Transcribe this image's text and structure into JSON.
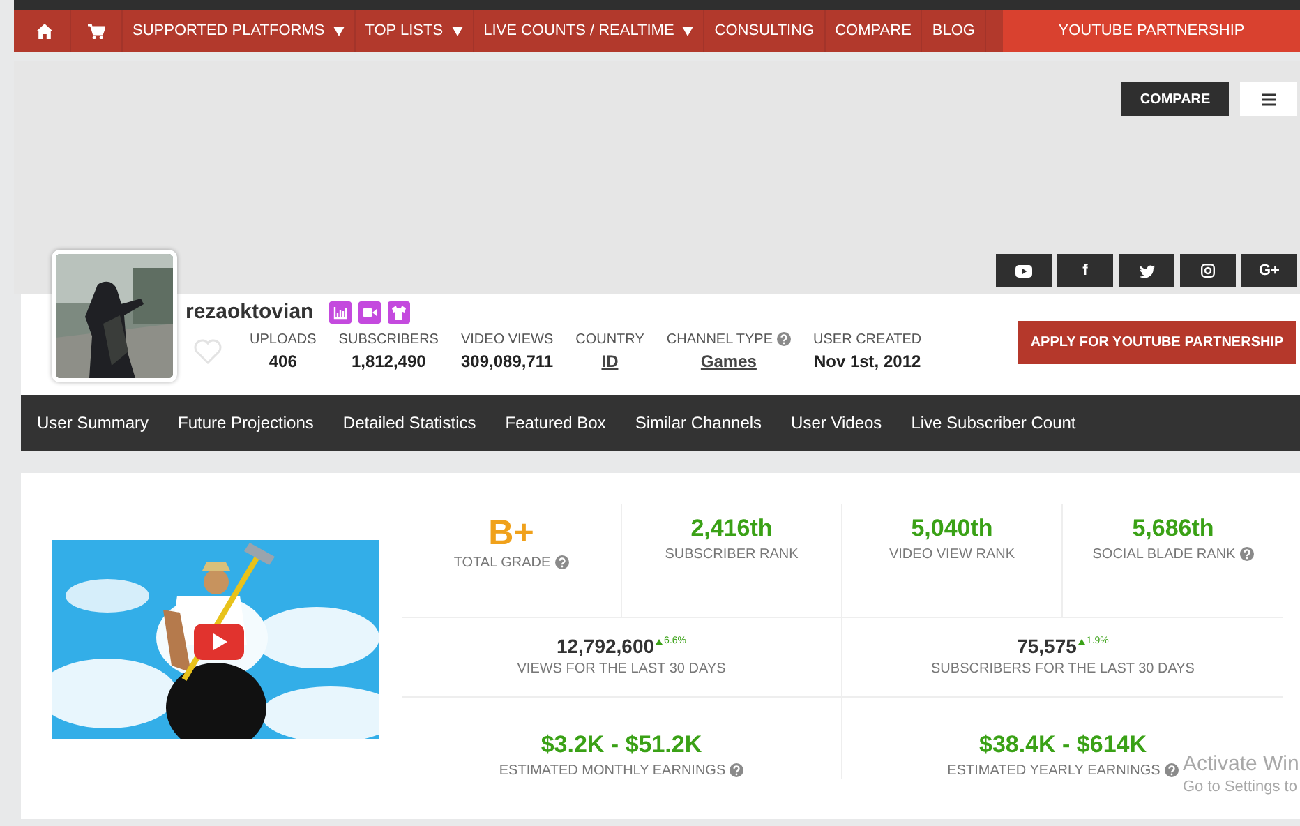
{
  "nav": {
    "items": [
      {
        "kind": "home"
      },
      {
        "kind": "cart"
      },
      {
        "kind": "text",
        "label": "SUPPORTED PLATFORMS",
        "dropdown": true
      },
      {
        "kind": "text",
        "label": "TOP LISTS",
        "dropdown": true
      },
      {
        "kind": "text",
        "label": "LIVE COUNTS / REALTIME",
        "dropdown": true
      },
      {
        "kind": "text",
        "label": "CONSULTING",
        "dropdown": false
      },
      {
        "kind": "text",
        "label": "COMPARE",
        "dropdown": false
      },
      {
        "kind": "text",
        "label": "BLOG",
        "dropdown": false
      }
    ],
    "partnership": "YOUTUBE PARTNERSHIP"
  },
  "banner": {
    "compare_button": "COMPARE",
    "social": [
      {
        "kind": "youtube"
      },
      {
        "kind": "facebook",
        "glyph": "f"
      },
      {
        "kind": "twitter"
      },
      {
        "kind": "instagram"
      },
      {
        "kind": "google",
        "glyph": "G+"
      }
    ]
  },
  "profile": {
    "name": "rezaoktovian",
    "badges": [
      {
        "kind": "chart"
      },
      {
        "kind": "video"
      },
      {
        "kind": "shirt"
      }
    ],
    "favorited": false,
    "stats": [
      {
        "label": "UPLOADS",
        "value": "406",
        "link": false,
        "help": false
      },
      {
        "label": "SUBSCRIBERS",
        "value": "1,812,490",
        "link": false,
        "help": false
      },
      {
        "label": "VIDEO VIEWS",
        "value": "309,089,711",
        "link": false,
        "help": false
      },
      {
        "label": "COUNTRY",
        "value": "ID",
        "link": true,
        "help": false
      },
      {
        "label": "CHANNEL TYPE",
        "value": "Games",
        "link": true,
        "help": true
      },
      {
        "label": "USER CREATED",
        "value": "Nov 1st, 2012",
        "link": false,
        "help": false
      }
    ],
    "apply_button": "APPLY FOR YOUTUBE PARTNERSHIP"
  },
  "tabs": [
    {
      "label": "User Summary",
      "selected": false
    },
    {
      "label": "Future Projections",
      "selected": false
    },
    {
      "label": "Detailed Statistics",
      "selected": false
    },
    {
      "label": "Featured Box",
      "selected": false
    },
    {
      "label": "Similar Channels",
      "selected": false
    },
    {
      "label": "User Videos",
      "selected": false
    },
    {
      "label": "Live Subscriber Count",
      "selected": false
    }
  ],
  "summary": {
    "cells": [
      {
        "kind": "grade",
        "value": "B+",
        "label": "TOTAL GRADE",
        "help": true
      },
      {
        "kind": "rank",
        "value": "2,416th",
        "label": "SUBSCRIBER RANK",
        "help": false
      },
      {
        "kind": "rank",
        "value": "5,040th",
        "label": "VIDEO VIEW RANK",
        "help": false
      },
      {
        "kind": "rank",
        "value": "5,686th",
        "label": "SOCIAL BLADE RANK",
        "help": true
      },
      {
        "kind": "count",
        "value": "12,792,600",
        "change": "6.6%",
        "label": "VIEWS FOR THE LAST 30 DAYS",
        "help": false
      },
      {
        "kind": "count",
        "value": "75,575",
        "change": "1.9%",
        "label": "SUBSCRIBERS FOR THE LAST 30 DAYS",
        "help": false
      },
      {
        "kind": "earnings",
        "value": "$3.2K - $51.2K",
        "label": "ESTIMATED MONTHLY EARNINGS",
        "help": true
      },
      {
        "kind": "earnings",
        "value": "$38.4K - $614K",
        "label": "ESTIMATED YEARLY EARNINGS",
        "help": true
      }
    ]
  },
  "os_notice": {
    "title": "Activate Win",
    "subtitle": "Go to Settings to"
  }
}
